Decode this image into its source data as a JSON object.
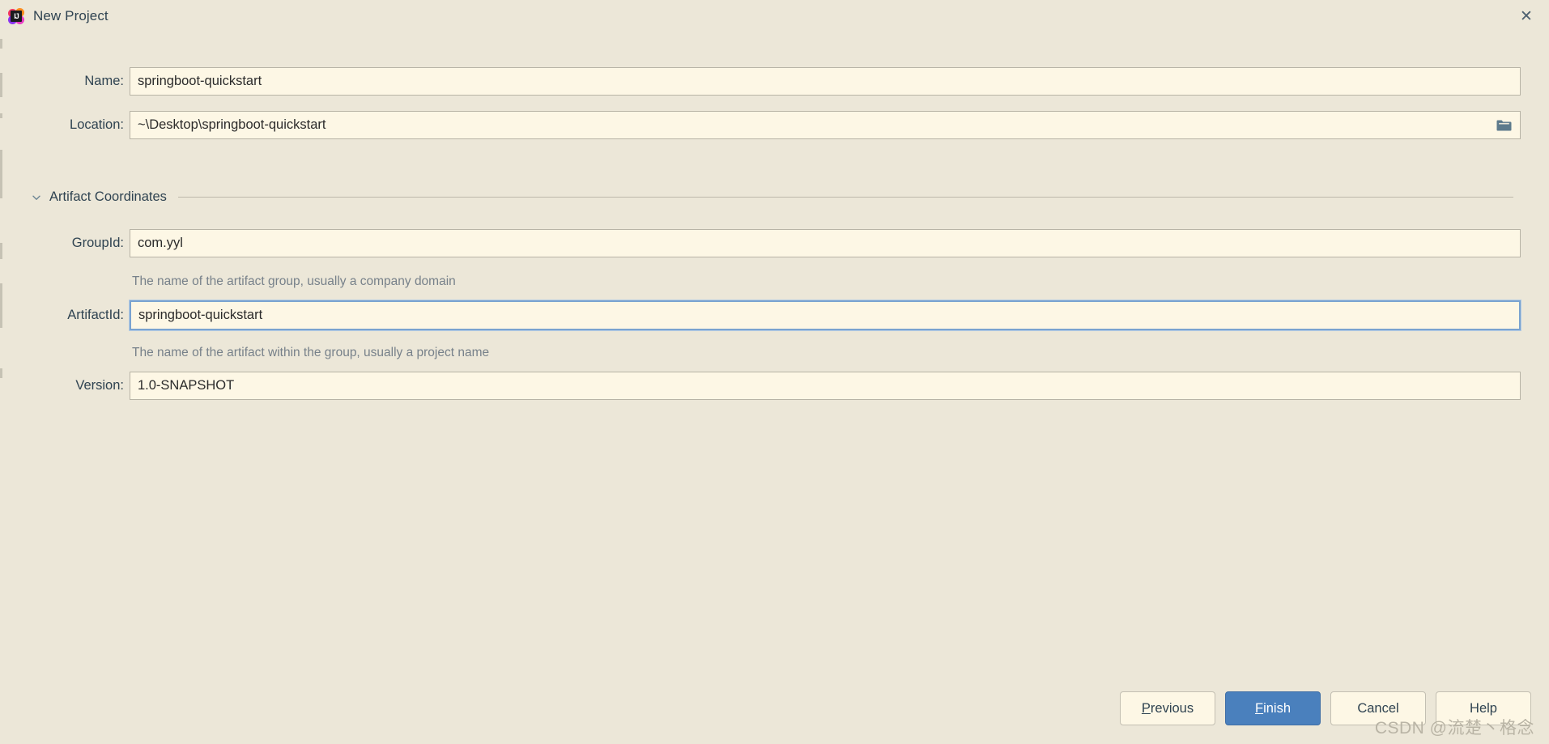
{
  "window": {
    "title": "New Project",
    "app_icon": "intellij-idea-icon",
    "close_label": "✕"
  },
  "form": {
    "name": {
      "label": "Name:",
      "value": "springboot-quickstart",
      "placeholder": ""
    },
    "location": {
      "label": "Location:",
      "value": "~\\Desktop\\springboot-quickstart",
      "placeholder": "",
      "browse_icon": "folder-icon"
    },
    "section": {
      "title": "Artifact Coordinates",
      "chevron": "chevron-down-icon"
    },
    "group_id": {
      "label": "GroupId:",
      "value": "com.yyl",
      "hint": "The name of the artifact group, usually a company domain"
    },
    "artifact_id": {
      "label": "ArtifactId:",
      "value": "springboot-quickstart",
      "hint": "The name of the artifact within the group, usually a project name"
    },
    "version": {
      "label": "Version:",
      "value": "1.0-SNAPSHOT",
      "hint": ""
    }
  },
  "footer": {
    "previous": {
      "mnemonic": "P",
      "rest": "revious"
    },
    "finish": {
      "mnemonic": "F",
      "rest": "inish"
    },
    "cancel": {
      "label": "Cancel"
    },
    "help": {
      "label": "Help"
    }
  },
  "watermark": "CSDN @流楚丶格念",
  "colors": {
    "background": "#ece7d8",
    "field_background": "#fdf7e5",
    "field_border": "#b8b4a6",
    "focus_border": "#7aa3d0",
    "primary_button": "#4a80bd",
    "text": "#2f4351",
    "hint_text": "#77818a"
  }
}
